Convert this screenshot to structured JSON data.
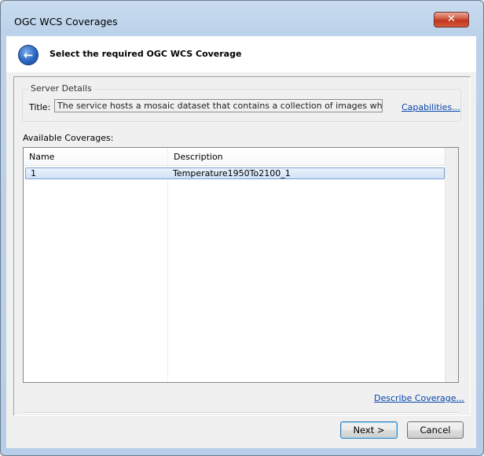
{
  "window": {
    "title": "OGC WCS Coverages",
    "close_glyph": "✕"
  },
  "header": {
    "back_glyph": "←",
    "title": "Select the required OGC WCS Coverage"
  },
  "server_details": {
    "group_label": "Server Details",
    "title_label": "Title:",
    "title_value": "The service hosts a mosaic dataset that contains a collection of images which represent",
    "capabilities_link": "Capabilities..."
  },
  "coverages": {
    "label": "Available Coverages:",
    "columns": [
      "Name",
      "Description"
    ],
    "rows": [
      {
        "name": "1",
        "description": "Temperature1950To2100_1"
      }
    ]
  },
  "describe_link": "Describe Coverage...",
  "buttons": {
    "next": "Next >",
    "cancel": "Cancel"
  },
  "colors": {
    "link": "#0645ad",
    "selection": "#cfe2f8",
    "close": "#c2361f"
  }
}
